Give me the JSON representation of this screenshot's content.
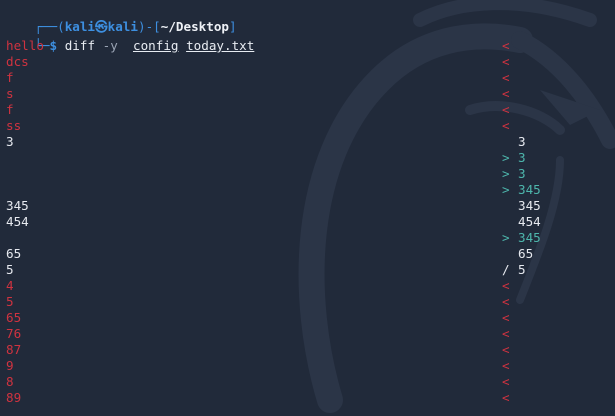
{
  "prompt": {
    "corner_top": "┌──",
    "open_paren": "(",
    "user": "kali",
    "at_symbol": "㉿",
    "host": "kali",
    "close_paren": ")",
    "dash": "-",
    "open_bracket": "[",
    "path": "~/Desktop",
    "close_bracket": "]",
    "corner_bottom": "└─",
    "dollar": "$",
    "command": "diff",
    "option": "-y",
    "arg1": "config",
    "arg2": "today.txt"
  },
  "diff_rows": [
    {
      "left": "hello",
      "marker": "<",
      "right": "",
      "kind": "removed"
    },
    {
      "left": "dcs",
      "marker": "<",
      "right": "",
      "kind": "removed"
    },
    {
      "left": "f",
      "marker": "<",
      "right": "",
      "kind": "removed"
    },
    {
      "left": "s",
      "marker": "<",
      "right": "",
      "kind": "removed"
    },
    {
      "left": "f",
      "marker": "<",
      "right": "",
      "kind": "removed"
    },
    {
      "left": "ss",
      "marker": "<",
      "right": "",
      "kind": "removed"
    },
    {
      "left": "3",
      "marker": "",
      "right": "3",
      "kind": "same"
    },
    {
      "left": "",
      "marker": ">",
      "right": "3",
      "kind": "added"
    },
    {
      "left": "",
      "marker": ">",
      "right": "3",
      "kind": "added"
    },
    {
      "left": "",
      "marker": ">",
      "right": "345",
      "kind": "added"
    },
    {
      "left": "345",
      "marker": "",
      "right": "345",
      "kind": "same"
    },
    {
      "left": "454",
      "marker": "",
      "right": "454",
      "kind": "same"
    },
    {
      "left": "",
      "marker": ">",
      "right": "345",
      "kind": "added"
    },
    {
      "left": "65",
      "marker": "",
      "right": "65",
      "kind": "same"
    },
    {
      "left": "5",
      "marker": "/",
      "right": "5",
      "kind": "changed"
    },
    {
      "left": "4",
      "marker": "<",
      "right": "",
      "kind": "removed"
    },
    {
      "left": "5",
      "marker": "<",
      "right": "",
      "kind": "removed"
    },
    {
      "left": "65",
      "marker": "<",
      "right": "",
      "kind": "removed"
    },
    {
      "left": "76",
      "marker": "<",
      "right": "",
      "kind": "removed"
    },
    {
      "left": "87",
      "marker": "<",
      "right": "",
      "kind": "removed"
    },
    {
      "left": "9",
      "marker": "<",
      "right": "",
      "kind": "removed"
    },
    {
      "left": "8",
      "marker": "<",
      "right": "",
      "kind": "removed"
    },
    {
      "left": "89",
      "marker": "<",
      "right": "",
      "kind": "removed"
    }
  ],
  "colors": {
    "background": "#212a3a",
    "prompt": "#3d8fe0",
    "removed": "#cf3340",
    "added": "#4db6ac",
    "text": "#e6e9ef"
  }
}
